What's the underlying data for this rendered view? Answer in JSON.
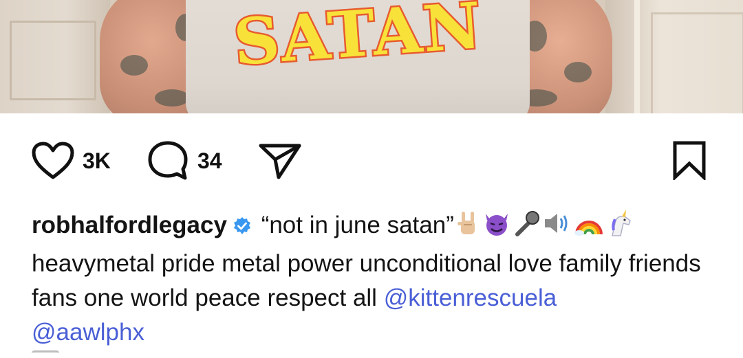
{
  "photo": {
    "shirt_text": "SATAN",
    "colors": {
      "text_fill": "#f8e23a",
      "text_stroke": "#e85b2f"
    }
  },
  "actions": {
    "like_count": "3K",
    "comment_count": "34",
    "icons": [
      "heart-icon",
      "comment-icon",
      "share-icon",
      "bookmark-icon"
    ]
  },
  "caption": {
    "username": "robhalfordlegacy",
    "text_line1": "“not in june satan”",
    "emojis": [
      "rock-on-hand",
      "smiling-devil",
      "microphone",
      "speaker",
      "rainbow",
      "unicorn"
    ],
    "body": "heavymetal pride metal power unconditional love family friends fans one world peace respect all",
    "mentions": [
      "@kittenrescuela",
      "@aawlphx"
    ],
    "mention_color": "#4a5fd6"
  }
}
